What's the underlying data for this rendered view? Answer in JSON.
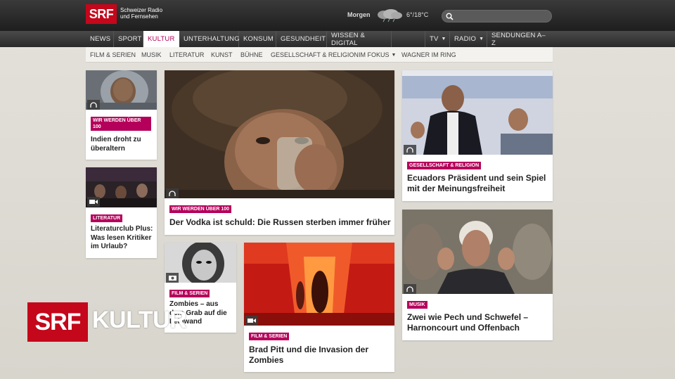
{
  "header": {
    "logo": "SRF",
    "logo_sub": "Schweizer Radio und Fernsehen",
    "weather_label": "Morgen",
    "weather_icon": "cloud-rain-icon",
    "weather_temp": "6°/18°C",
    "search_placeholder": ""
  },
  "mainnav": {
    "items": [
      {
        "label": "NEWS"
      },
      {
        "label": "SPORT"
      },
      {
        "label": "KULTUR",
        "active": true
      },
      {
        "label": "UNTERHALTUNG"
      },
      {
        "label": "KONSUM"
      },
      {
        "label": "GESUNDHEIT"
      },
      {
        "label": "WISSEN & DIGITAL"
      },
      {
        "label": "TV"
      },
      {
        "label": "RADIO"
      },
      {
        "label": "SENDUNGEN A–Z"
      }
    ]
  },
  "subnav": {
    "items": [
      {
        "label": "FILM & SERIEN"
      },
      {
        "label": "MUSIK"
      },
      {
        "label": "LITERATUR"
      },
      {
        "label": "KUNST"
      },
      {
        "label": "BÜHNE"
      },
      {
        "label": "GESELLSCHAFT & RELIGION"
      },
      {
        "label": "IM FOKUS"
      },
      {
        "label": "WAGNER IM RING"
      }
    ]
  },
  "cards": [
    {
      "tag": "WIR WERDEN ÜBER 100",
      "headline": "Indien droht zu überaltern",
      "media": "audio-icon"
    },
    {
      "tag": "LITERATUR",
      "headline": "Literaturclub Plus: Was lesen Kritiker im Urlaub?",
      "media": "video-icon"
    },
    {
      "tag": "WIR WERDEN ÜBER 100",
      "headline": "Der Vodka ist schuld: Die Russen sterben immer früher",
      "media": "audio-icon"
    },
    {
      "tag": "FILM & SERIEN",
      "headline": "Zombies – aus dem Grab auf die Leinwand",
      "media": "photo-icon"
    },
    {
      "tag": "FILM & SERIEN",
      "headline": "Brad Pitt und die Invasion der Zombies",
      "media": "video-icon"
    },
    {
      "tag": "GESELLSCHAFT & RELIGION",
      "headline": "Ecuadors Präsident und sein Spiel mit der Meinungsfreiheit",
      "media": "audio-icon"
    },
    {
      "tag": "MUSIK",
      "headline": "Zwei wie Pech und Schwefel – Harnoncourt und Offenbach",
      "media": "audio-icon"
    }
  ],
  "branding": {
    "srf": "SRF",
    "section": "KULTUR"
  },
  "colors": {
    "brand_red": "#c4071b",
    "tag_magenta": "#b5005b",
    "nav_dark": "#2a2a2a"
  }
}
